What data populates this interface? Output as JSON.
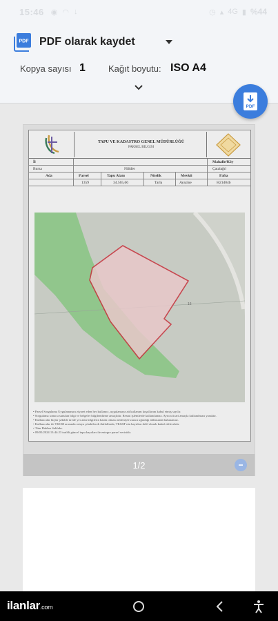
{
  "status_bar": {
    "time": "15:46",
    "battery": "%44",
    "network": "4G"
  },
  "header": {
    "title": "PDF olarak kaydet",
    "copies_label": "Kopya sayısı",
    "copies_value": "1",
    "paper_label": "Kağıt boyutu:",
    "paper_value": "ISO A4",
    "pdf_icon_text": "PDF"
  },
  "fab": {
    "label": "PDF"
  },
  "document": {
    "org_name": "TAPU VE KADASTRO GENEL MÜDÜRLÜĞÜ",
    "subtitle": "PARSEL BILGISI",
    "il_label": "İl",
    "mahalle_label": "Mahalle/Köy",
    "il_value": "Bursa",
    "ilce_value": "Nilüfer",
    "mahalle_value": "Çatalağıl",
    "columns": [
      "Ada",
      "Parsel",
      "Tapu Alanı",
      "Nitelik",
      "Mevkii",
      "Pafta"
    ],
    "values": [
      "",
      "1359",
      "34.565,66",
      "Tarla",
      "Ayazine",
      "H21d04b"
    ],
    "road_label": "16",
    "notes": [
      "Parsel Sorgulama Uygulamasını ziyaret eden her kullanıcı, uygulamaya ait kullanım koşullarını kabul etmiş sayılır.",
      "Sorgulama sonucu sunulan bilgi ve belgeler bilgilendirme amaçlıdır. Resmi işlemlerde kullanılamaz. Ayrıca ticari amaçla kullanılması yasaktır.",
      "Kullanıcılar hiçbir şekilde ürede yer alan bilgilerin hatalı olması nedeniyle zarara uğradığı iddiasında bulunamaz.",
      "Kullanıcılar ile TKGM arasında ortaya çıkabilecek ihtilaflarda, TKGM' nin kayıtları delil olarak kabul edilecektir.",
      "Tüm Hakları Saklıdır.",
      "09/05/2024 13:44:23 tarihli güncel tapu kayıtları ile entegre parsel verisidir."
    ]
  },
  "preview": {
    "page_indicator": "1/2"
  },
  "navbar": {
    "watermark": "ilanlar",
    "watermark_suffix": ".com"
  },
  "colors": {
    "accent": "#3b7ddd",
    "parcel_outline": "#c8323c",
    "map_green": "#7fc47a"
  }
}
